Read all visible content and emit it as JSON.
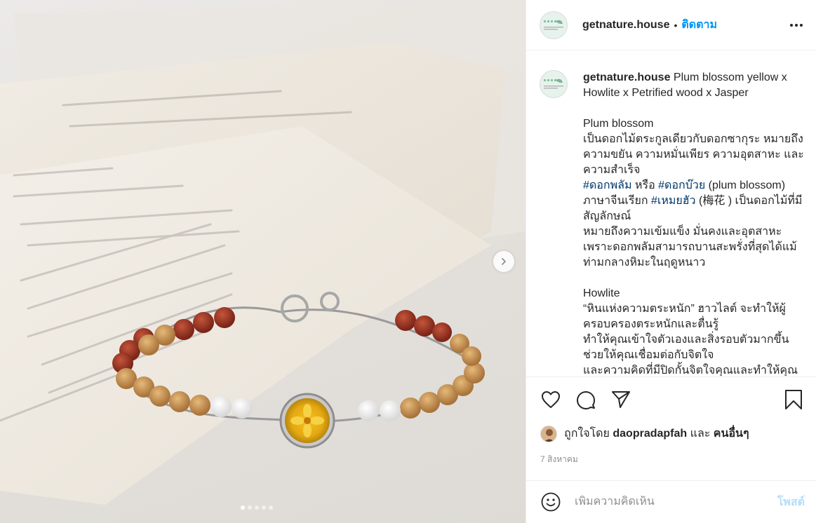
{
  "post": {
    "username": "getnature.house",
    "follow_label": "ติดตาม",
    "separator": "•",
    "caption_username": "getnature.house",
    "caption": [
      {
        "t": "text",
        "v": " Plum blossom yellow x Howlite x Petrified wood x Jasper\n\nPlum blossom\nเป็นดอกไม้ตระกูลเดียวกับดอกซากุระ หมายถึงความขยัน ความหมั่นเพียร ความอุตสาหะ และความสำเร็จ\n"
      },
      {
        "t": "tag",
        "v": "#ดอกพลัม"
      },
      {
        "t": "text",
        "v": " หรือ "
      },
      {
        "t": "tag",
        "v": "#ดอกบ๊วย"
      },
      {
        "t": "text",
        "v": " (plum blossom) ภาษาจีนเรียก "
      },
      {
        "t": "tag",
        "v": "#เหมยฮัว"
      },
      {
        "t": "text",
        "v": " (梅花 ) เป็นดอกไม้ที่มีสัญลักษณ์\nหมายถึงความเข้มแข็ง มั่นคงและอุตสาหะ เพราะดอกพลัมสามารถบานสะพรั่งที่สุดได้แม้ท่ามกลางหิมะในฤดูหนาว\n\nHowlite\n“หินแห่งความตระหนัก” ฮาวไลต์ จะทำให้ผู้ครอบครองตระหนักและตื่นรู้\nทำให้คุณเข้าใจตัวเองและสิ่งรอบตัวมากขึ้น ช่วยให้คุณเชื่อมต่อกับจิตใจ\nและความคิดที่มีปิดกั้นจิตใจคุณและทำให้คุณ"
      }
    ],
    "likes": {
      "prefix": "ถูกใจโดย",
      "user": "daopradapfah",
      "conj": "และ",
      "others": "คนอื่นๆ"
    },
    "date": "7 สิงหาคม",
    "comment_placeholder": "เพิ่มความคิดเห็น",
    "post_label": "โพสต์"
  },
  "carousel": {
    "count": 5,
    "active": 0
  },
  "icons": {
    "more": "more-horizontal-icon",
    "like": "heart-icon",
    "comment": "comment-icon",
    "share": "send-icon",
    "save": "bookmark-icon",
    "emoji": "emoji-icon",
    "next": "chevron-right-icon"
  },
  "colors": {
    "accent": "#0095f6",
    "post_disabled": "#b2dffc",
    "hashtag": "#00376b",
    "muted": "#8e8e8e"
  }
}
